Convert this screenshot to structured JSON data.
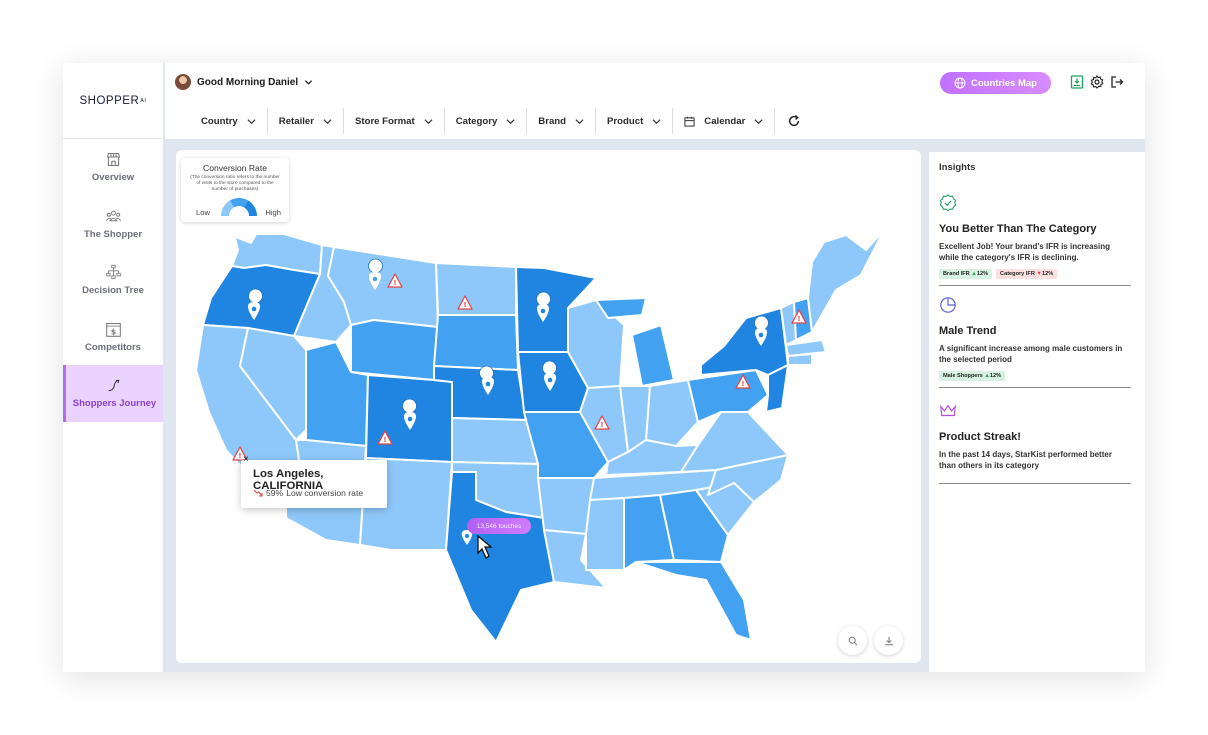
{
  "app": {
    "logo": "SHOPPER",
    "logo_sup": "AI"
  },
  "sidebar": {
    "items": [
      {
        "label": "Overview",
        "icon": "store-icon"
      },
      {
        "label": "The Shopper",
        "icon": "people-icon"
      },
      {
        "label": "Decision Tree",
        "icon": "tree-icon"
      },
      {
        "label": "Competitors",
        "icon": "dollar-box-icon"
      },
      {
        "label": "Shoppers Journey",
        "icon": "journey-icon",
        "active": true
      }
    ]
  },
  "header": {
    "greeting": "Good Morning Daniel",
    "countries_map_label": "Countries Map",
    "filters": [
      "Country",
      "Retailer",
      "Store Format",
      "Category",
      "Brand",
      "Product",
      "Calendar"
    ]
  },
  "map": {
    "legend": {
      "title": "Conversion Rate",
      "description": "(The conversion ratio refers to the number of visits to the store compared to the number of purchases)",
      "low": "Low",
      "high": "High"
    },
    "tooltip": {
      "title": "Los Angeles, CALIFORNIA",
      "percent": "59%",
      "text": "Low conversion rate",
      "close": "×"
    },
    "touch_badge": "13,546 touches"
  },
  "insights": {
    "title": "Insights",
    "cards": [
      {
        "icon": "verified-check-icon",
        "title": "You Better Than The Category",
        "desc": "Excellent Job! Your brand's IFR is increasing while the category's IFR is declining.",
        "tags": [
          {
            "label": "Brand IFR",
            "delta": "12%",
            "dir": "up"
          },
          {
            "label": "Category IFR",
            "delta": "12%",
            "dir": "down"
          }
        ]
      },
      {
        "icon": "pie-chart-icon",
        "title": "Male Trend",
        "desc": "A significant increase among male customers in the selected period",
        "tags": [
          {
            "label": "Male Shoppers",
            "delta": "12%",
            "dir": "up"
          }
        ]
      },
      {
        "icon": "crown-icon",
        "title": "Product Streak!",
        "desc": "In the past 14 days, StarKist performed better than others in its category",
        "tags": []
      }
    ]
  },
  "colors": {
    "accent": "#c070ff",
    "dark_blue": "#2085e0",
    "mid_blue": "#42a1f0",
    "light_blue": "#8ec8fa"
  }
}
